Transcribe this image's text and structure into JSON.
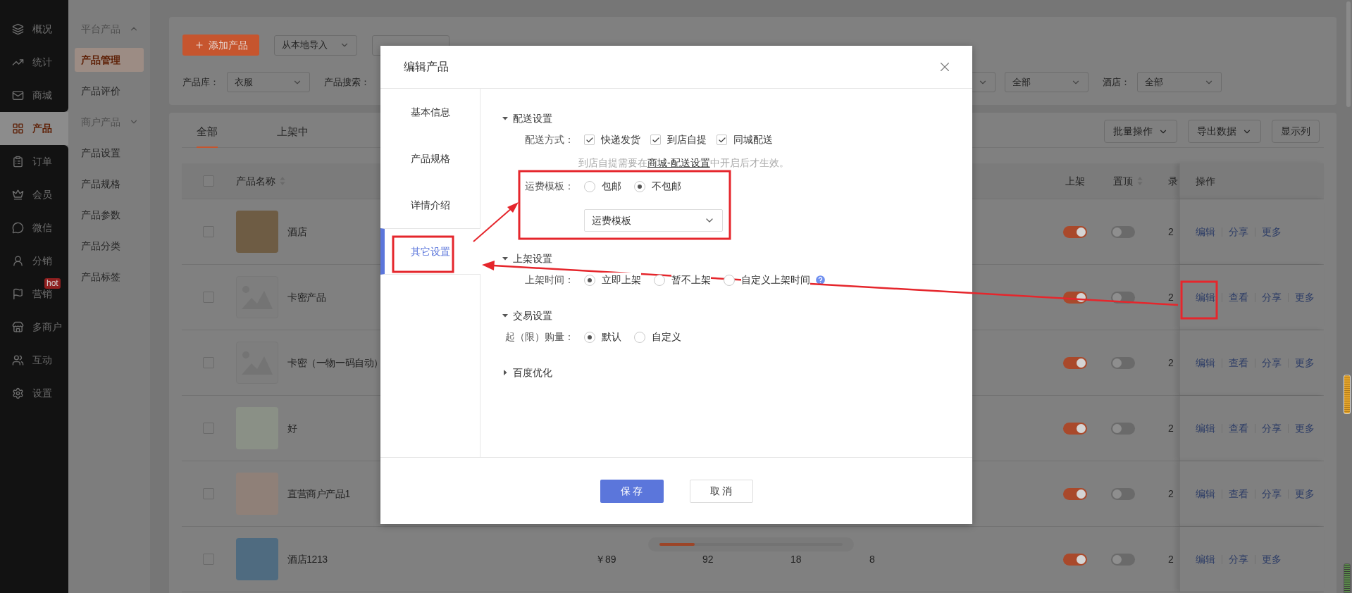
{
  "sidebar": {
    "items": [
      {
        "label": "概况",
        "selected": false
      },
      {
        "label": "统计",
        "selected": false
      },
      {
        "label": "商城",
        "selected": false
      },
      {
        "label": "产品",
        "selected": true
      },
      {
        "label": "订单",
        "selected": false
      },
      {
        "label": "会员",
        "selected": false
      },
      {
        "label": "微信",
        "selected": false
      },
      {
        "label": "分销",
        "selected": false
      },
      {
        "label": "营销",
        "selected": false,
        "badge": "hot"
      },
      {
        "label": "多商户",
        "selected": false
      },
      {
        "label": "互动",
        "selected": false
      },
      {
        "label": "设置",
        "selected": false
      }
    ]
  },
  "subnav": {
    "items": [
      {
        "kind": "group",
        "label": "平台产品",
        "expanded": true,
        "children": [
          {
            "label": "产品管理",
            "selected": true
          },
          {
            "label": "产品评价",
            "selected": false
          }
        ]
      },
      {
        "kind": "group",
        "label": "商户产品",
        "expanded": false
      },
      {
        "kind": "item",
        "label": "产品设置",
        "selected": false
      },
      {
        "kind": "item",
        "label": "产品规格",
        "selected": false
      },
      {
        "kind": "item",
        "label": "产品参数",
        "selected": false
      },
      {
        "kind": "item",
        "label": "产品分类",
        "selected": false
      },
      {
        "kind": "item",
        "label": "产品标签",
        "selected": false
      }
    ]
  },
  "toolbar": {
    "add_button": "添加产品",
    "import_select": "从本地导入"
  },
  "filters": {
    "library_label": "产品库：",
    "library_value": "衣服",
    "search_label": "产品搜索：",
    "status_value": "全部",
    "hotel_label": "酒店：",
    "hotel_value": "全部"
  },
  "tabs": [
    {
      "label": "全部",
      "selected": true
    },
    {
      "label": "上架中",
      "selected": false
    }
  ],
  "actions": [
    "批量操作",
    "导出数据",
    "显示列"
  ],
  "table": {
    "select_all": {
      "checked": false
    },
    "columns": {
      "name": "产品名称",
      "on_shelf": "上架",
      "pinned": "置顶",
      "column_9": "录",
      "actions": "操作"
    },
    "rows": [
      {
        "checked": false,
        "kind": "photo",
        "name": "酒店",
        "on_shelf": true,
        "pinned": false,
        "column_9": "2",
        "actions": [
          "编辑",
          "分享",
          "更多"
        ]
      },
      {
        "checked": false,
        "kind": "placeholder",
        "name": "卡密产品",
        "on_shelf": true,
        "pinned": false,
        "column_9": "2",
        "actions": [
          "编辑",
          "查看",
          "分享",
          "更多"
        ]
      },
      {
        "checked": false,
        "kind": "placeholder",
        "name": "卡密（一物一码自动）",
        "on_shelf": true,
        "pinned": false,
        "column_9": "2",
        "actions": [
          "编辑",
          "查看",
          "分享",
          "更多"
        ]
      },
      {
        "checked": false,
        "kind": "photo",
        "name": "好",
        "on_shelf": true,
        "pinned": false,
        "column_9": "2",
        "actions": [
          "编辑",
          "查看",
          "分享",
          "更多"
        ]
      },
      {
        "checked": false,
        "kind": "photo",
        "name": "直营商户产品1",
        "on_shelf": true,
        "pinned": false,
        "column_9": "2",
        "actions": [
          "编辑",
          "查看",
          "分享",
          "更多"
        ]
      },
      {
        "checked": false,
        "kind": "photo",
        "name": "酒店1213",
        "price": "￥89",
        "column_4": "92",
        "column_5": "18",
        "column_6": "8",
        "on_shelf": true,
        "pinned": false,
        "column_9": "2",
        "actions": [
          "编辑",
          "分享",
          "更多"
        ]
      }
    ]
  },
  "modal": {
    "title": "编辑产品",
    "tabs": [
      {
        "label": "基本信息",
        "selected": false
      },
      {
        "label": "产品规格",
        "selected": false
      },
      {
        "label": "详情介绍",
        "selected": false
      },
      {
        "label": "其它设置",
        "selected": true
      }
    ],
    "sections": [
      {
        "title": "配送设置",
        "expanded": true,
        "fields": [
          {
            "kind": "checkboxes",
            "label": "配送方式：",
            "options": [
              {
                "label": "快递发货",
                "checked": true
              },
              {
                "label": "到店自提",
                "checked": true
              },
              {
                "label": "同城配送",
                "checked": true
              }
            ]
          },
          {
            "kind": "hint",
            "text_before": "到店自提需要在",
            "link": "商城-配送设置",
            "text_after": "中开启后才生效。"
          },
          {
            "kind": "radios",
            "label": "运费模板：",
            "options": [
              {
                "label": "包邮",
                "selected": false
              },
              {
                "label": "不包邮",
                "selected": true
              }
            ]
          },
          {
            "kind": "select",
            "value": "运费模板"
          }
        ]
      },
      {
        "title": "上架设置",
        "expanded": true,
        "fields": [
          {
            "kind": "radios",
            "label": "上架时间：",
            "options": [
              {
                "label": "立即上架",
                "selected": true
              },
              {
                "label": "暂不上架",
                "selected": false
              },
              {
                "label": "自定义上架时间",
                "selected": false,
                "help": true
              }
            ]
          }
        ]
      },
      {
        "title": "交易设置",
        "expanded": true,
        "fields": [
          {
            "kind": "radios",
            "label": "起（限）购量：",
            "options": [
              {
                "label": "默认",
                "selected": true
              },
              {
                "label": "自定义",
                "selected": false
              }
            ]
          }
        ]
      },
      {
        "title": "百度优化",
        "expanded": false
      }
    ],
    "buttons": {
      "save": "保 存",
      "cancel": "取 消"
    }
  }
}
